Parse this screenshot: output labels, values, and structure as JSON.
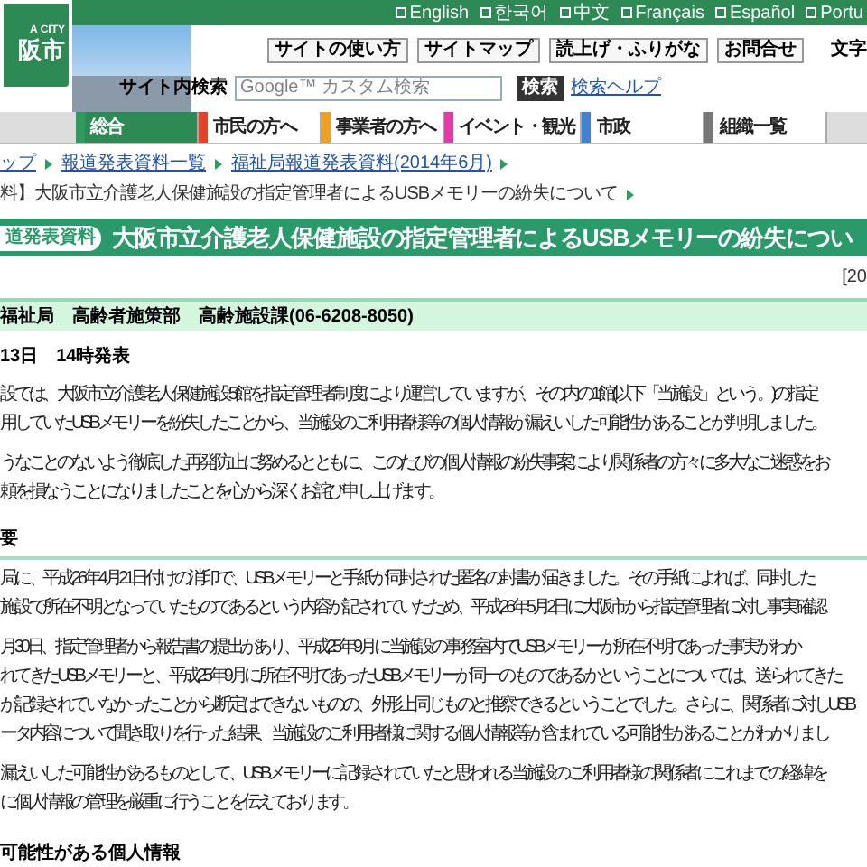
{
  "language_links": [
    "English",
    "한국어",
    "中文",
    "Français",
    "Español",
    "Portu"
  ],
  "logo": {
    "line1": "A CITY",
    "line2": "阪市"
  },
  "utility_links": [
    "サイトの使い方",
    "サイトマップ",
    "読上げ・ふりがな",
    "お問合せ"
  ],
  "font_size_label": "文字",
  "search": {
    "label": "サイト内検索",
    "placeholder": "Google™ カスタム検索",
    "button": "検索",
    "help": "検索ヘルプ"
  },
  "nav_tabs": [
    {
      "label": "総合",
      "selected": true,
      "color": "#2e9a5e"
    },
    {
      "label": "市民の方へ",
      "selected": false,
      "color": "#e2412a"
    },
    {
      "label": "事業者の方へ",
      "selected": false,
      "color": "#f0a01c"
    },
    {
      "label": "イベント・観光",
      "selected": false,
      "color": "#e43aa8"
    },
    {
      "label": "市政",
      "selected": false,
      "color": "#3f83d1"
    },
    {
      "label": "組織一覧",
      "selected": false,
      "color": "#777777"
    }
  ],
  "breadcrumbs": [
    "ップ",
    "報道発表資料一覧",
    "福祉局報道発表資料(2014年6月)"
  ],
  "current_page": "料】大阪市立介護老人保健施設の指定管理者によるUSBメモリーの紛失について",
  "title": {
    "badge": "道発表資料",
    "text": "大阪市立介護老人保健施設の指定管理者によるUSBメモリーの紛失につい"
  },
  "date_stamp": "[20",
  "department": "福祉局　高齢者施策部　高齢施設課(06-6208-8050)",
  "release": "13日　14時発表",
  "intro": [
    [
      "設では、大阪市立介護老人保健施設5館を指定管理者制度により運営していますが、その内の1館(以下「当施設」という。)の指定",
      "用していたUSBメモリーを紛失したことから、当施設のご利用者様等の個人情報が漏えいした可能性があることが判明しました。"
    ],
    [
      "うなことのないよう徹底した再発防止に努めるとともに、このたびの個人情報の紛失事案により関係者の方々に多大なご迷惑をお",
      "頼を損なうことになりましたことを心から深くお詫び申し上げます。"
    ]
  ],
  "sections": [
    {
      "heading": "要",
      "paragraphs": [
        [
          "局に、平成26年4月21日付けの消印で、USBメモリーと手紙が同封された匿名の封書が届きました。その手紙によれば、同封した",
          "施設で所在不明となっていたものであるという内容が記されていたため、平成26年5月2日に大阪市から指定管理者に対し事実確認"
        ],
        [
          "月30日、指定管理者から報告書の提出があり、平成25年9月に当施設の事務室内でUSBメモリーが所在不明であった事実がわか",
          "れてきたUSBメモリーと、平成25年9月に所在不明であったUSBメモリーが同一のものであるかということについては、送られてきた",
          "が記録されていなかったことから断定はできないものの、外形上同じものと推察できるということでした。さらに、関係者に対しUSB",
          "ータ内容について聞き取りを行った結果、当施設のご利用者様に関する個人情報等が含まれている可能性があることがわかりまし"
        ],
        [
          "漏えいした可能性があるものとして、USBメモリーに記録されていたと思われる当施設のご利用者様の関係者にこれまでの経緯を",
          "に個人情報の管理を厳重に行うことを伝えております。"
        ]
      ]
    },
    {
      "heading": "可能性がある個人情報"
    }
  ]
}
